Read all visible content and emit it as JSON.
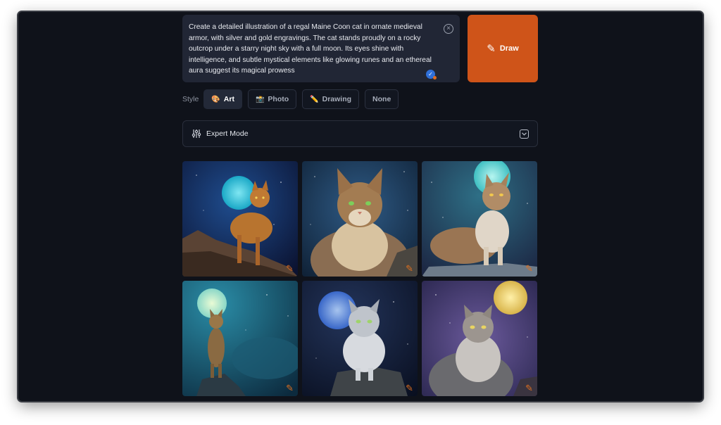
{
  "prompt": {
    "text": "Create a detailed illustration of a regal Maine Coon cat in ornate medieval armor, with silver and gold engravings. The cat stands proudly on a rocky outcrop under a starry night sky with a full moon. Its eyes shine with intelligence, and subtle mystical elements like glowing runes and an ethereal aura suggest its magical prowess"
  },
  "draw_button": {
    "label": "Draw",
    "icon": "pencil-icon"
  },
  "style": {
    "label": "Style",
    "options": [
      {
        "label": "Art",
        "icon": "palette-icon",
        "glyph": "🎨",
        "selected": true
      },
      {
        "label": "Photo",
        "icon": "camera-icon",
        "glyph": "📸",
        "selected": false
      },
      {
        "label": "Drawing",
        "icon": "pencil-icon",
        "glyph": "✏️",
        "selected": false
      },
      {
        "label": "None",
        "icon": "",
        "glyph": "",
        "selected": false
      }
    ]
  },
  "expert_mode": {
    "label": "Expert Mode",
    "icon": "sliders-icon",
    "toggle_icon": "chevron-down-icon"
  },
  "colors": {
    "accent": "#cf5419",
    "background": "#0f121a",
    "panel": "#212635"
  }
}
